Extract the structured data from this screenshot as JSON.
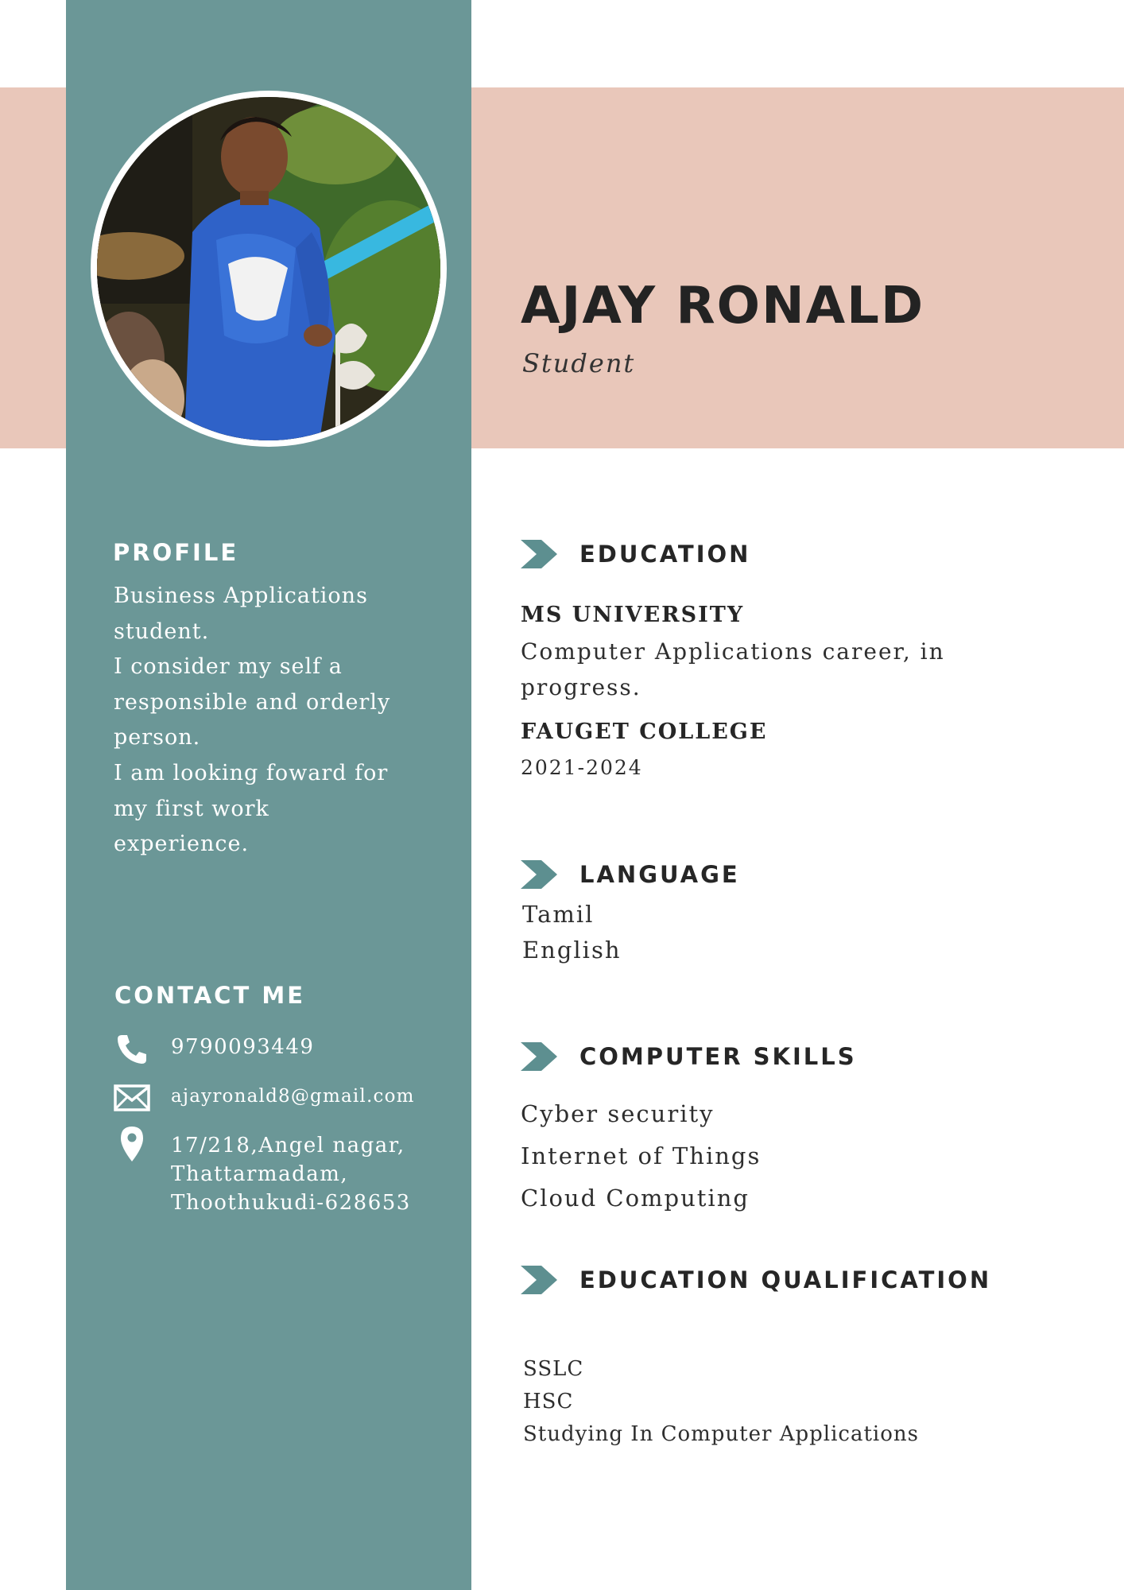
{
  "header": {
    "name": "AJAY RONALD",
    "role": "Student"
  },
  "profile": {
    "heading": "PROFILE",
    "lines": [
      "Business Applications",
      "student.",
      "I consider my self a",
      "responsible and orderly",
      "person.",
      "I am looking foward for",
      "my first work",
      "experience."
    ]
  },
  "contact": {
    "heading": "CONTACT ME",
    "phone": "9790093449",
    "email": "ajayronald8@gmail.com",
    "address": [
      "17/218,Angel nagar,",
      "Thattarmadam,",
      "Thoothukudi-628653"
    ],
    "icons": [
      "phone-icon",
      "mail-icon",
      "location-pin-icon"
    ]
  },
  "education": {
    "heading": "EDUCATION",
    "entries": [
      {
        "institution": "MS UNIVERSITY",
        "details": [
          "Computer Applications career, in",
          "progress."
        ]
      },
      {
        "institution": "FAUGET COLLEGE",
        "details": [
          "2021-2024"
        ]
      }
    ]
  },
  "language": {
    "heading": "LANGUAGE",
    "items": [
      "Tamil",
      "English"
    ]
  },
  "skills": {
    "heading": "COMPUTER SKILLS",
    "items": [
      "Cyber security",
      "Internet of Things",
      "Cloud Computing"
    ]
  },
  "qualification": {
    "heading": "EDUCATION QUALIFICATION",
    "items": [
      "SSLC",
      "HSC",
      "Studying In Computer Applications"
    ]
  },
  "colors": {
    "sidebar": "#6b9797",
    "header_band": "#e9c7ba",
    "accent_chevron": "#5d8f90",
    "heading_text": "#262626"
  }
}
